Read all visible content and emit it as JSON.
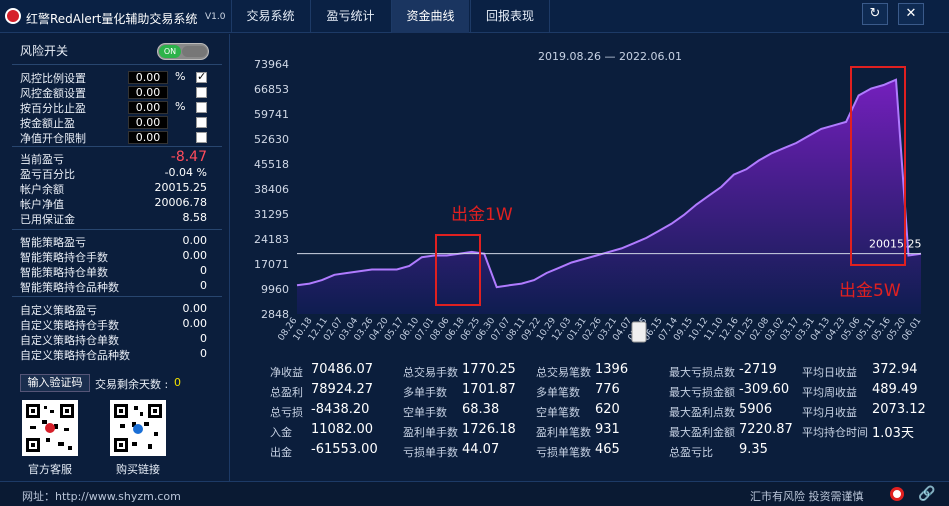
{
  "app": {
    "title": "红警RedAlert量化辅助交易系统",
    "version": "V1.0"
  },
  "tabs": [
    "交易系统",
    "盈亏统计",
    "资金曲线",
    "回报表现"
  ],
  "window_buttons": {
    "refresh": "↻",
    "close": "✕"
  },
  "risk": {
    "switch_label": "风险开关",
    "switch_state": "ON",
    "settings": [
      {
        "label": "风控比例设置",
        "value": "0.00",
        "unit": "%",
        "checked": true
      },
      {
        "label": "风控金额设置",
        "value": "0.00",
        "unit": "",
        "checked": false
      },
      {
        "label": "按百分比止盈",
        "value": "0.00",
        "unit": "%",
        "checked": false
      },
      {
        "label": "按金额止盈",
        "value": "0.00",
        "unit": "",
        "checked": false
      },
      {
        "label": "净值开仓限制",
        "value": "0.00",
        "unit": "",
        "checked": false
      }
    ]
  },
  "account": [
    {
      "label": "当前盈亏",
      "value": "-8.47"
    },
    {
      "label": "盈亏百分比",
      "value": "-0.04 %"
    },
    {
      "label": "帐户余额",
      "value": "20015.25"
    },
    {
      "label": "帐户净值",
      "value": "20006.78"
    },
    {
      "label": "已用保证金",
      "value": "8.58"
    }
  ],
  "smart": [
    {
      "label": "智能策略盈亏",
      "value": "0.00"
    },
    {
      "label": "智能策略持仓手数",
      "value": "0.00"
    },
    {
      "label": "智能策略持仓单数",
      "value": "0"
    },
    {
      "label": "智能策略持仓品种数",
      "value": "0"
    }
  ],
  "custom": [
    {
      "label": "自定义策略盈亏",
      "value": "0.00"
    },
    {
      "label": "自定义策略持仓手数",
      "value": "0.00"
    },
    {
      "label": "自定义策略持仓单数",
      "value": "0"
    },
    {
      "label": "自定义策略持仓品种数",
      "value": "0"
    }
  ],
  "verify": {
    "button": "输入验证码",
    "days_label": "交易剩余天数 :",
    "days_value": "0"
  },
  "qr": {
    "service": "官方客服",
    "buy": "购买链接"
  },
  "chart_data": {
    "type": "area",
    "title": "2019.08.26 — 2022.06.01",
    "y_ticks": [
      "73964",
      "66853",
      "59741",
      "52630",
      "45518",
      "38406",
      "31295",
      "24183",
      "17071",
      "9960",
      "2848"
    ],
    "ylim": [
      2848,
      73964
    ],
    "x_ticks": [
      "08.26",
      "10.18",
      "12.11",
      "02.07",
      "03.04",
      "03.26",
      "04.20",
      "05.17",
      "06.10",
      "07.01",
      "08.06",
      "06.18",
      "06.25",
      "06.30",
      "07.07",
      "08.11",
      "09.22",
      "10.29",
      "12.03",
      "01.31",
      "02.26",
      "03.21",
      "04.07",
      "05.05",
      "06.15",
      "07.14",
      "09.15",
      "10.12",
      "11.10",
      "12.16",
      "01.25",
      "02.08",
      "03.02",
      "03.17",
      "03.31",
      "04.13",
      "04.23",
      "05.06",
      "05.11",
      "05.16",
      "05.20",
      "06.01"
    ],
    "current_label": "20015.25",
    "current_value": 20015.25,
    "annotations": [
      {
        "text": "出金1W"
      },
      {
        "text": "出金5W"
      }
    ],
    "series": [
      {
        "x": [
          0,
          2,
          4,
          6,
          8,
          10,
          12,
          14,
          16,
          18,
          20,
          22,
          24,
          26,
          28,
          30,
          32,
          34,
          36,
          38,
          40,
          42,
          44,
          46,
          48,
          50,
          52,
          54,
          56,
          58,
          60,
          62,
          64,
          66,
          68,
          70,
          72,
          74,
          76,
          78,
          80,
          82,
          84,
          86,
          88,
          90,
          92,
          94,
          96,
          98,
          100
        ],
        "values": [
          11000,
          11500,
          12500,
          14000,
          14500,
          15000,
          15500,
          15500,
          15500,
          16500,
          19000,
          19500,
          19500,
          20000,
          20500,
          20000,
          10500,
          11000,
          11500,
          12500,
          14500,
          16000,
          17500,
          18500,
          19500,
          20500,
          21500,
          23000,
          24500,
          26500,
          28500,
          31000,
          34000,
          36500,
          39000,
          42500,
          44000,
          46500,
          48500,
          50000,
          51500,
          53500,
          55500,
          56500,
          57500,
          65000,
          67000,
          68000,
          69500,
          19500,
          20015
        ]
      }
    ]
  },
  "stats": [
    {
      "label": "净收益",
      "value": "70486.07"
    },
    {
      "label": "总盈利",
      "value": "78924.27"
    },
    {
      "label": "总亏损",
      "value": "-8438.20"
    },
    {
      "label": "入金",
      "value": "11082.00"
    },
    {
      "label": "出金",
      "value": "-61553.00"
    },
    {
      "label": "总交易手数",
      "value": "1770.25"
    },
    {
      "label": "多单手数",
      "value": "1701.87"
    },
    {
      "label": "空单手数",
      "value": "68.38"
    },
    {
      "label": "盈利单手数",
      "value": "1726.18"
    },
    {
      "label": "亏损单手数",
      "value": "44.07"
    },
    {
      "label": "总交易笔数",
      "value": "1396"
    },
    {
      "label": "多单笔数",
      "value": "776"
    },
    {
      "label": "空单笔数",
      "value": "620"
    },
    {
      "label": "盈利单笔数",
      "value": "931"
    },
    {
      "label": "亏损单笔数",
      "value": "465"
    },
    {
      "label": "最大亏损点数",
      "value": "-2719"
    },
    {
      "label": "最大亏损金额",
      "value": "-309.60"
    },
    {
      "label": "最大盈利点数",
      "value": "5906"
    },
    {
      "label": "最大盈利金额",
      "value": "7220.87"
    },
    {
      "label": "总盈亏比",
      "value": "9.35"
    },
    {
      "label": "平均日收益",
      "value": "372.94"
    },
    {
      "label": "平均周收益",
      "value": "489.49"
    },
    {
      "label": "平均月收益",
      "value": "2073.12"
    },
    {
      "label": "平均持仓时间",
      "value": "1.03天"
    }
  ],
  "footer": {
    "url": "网址：http://www.shyzm.com",
    "risk": "汇市有风险  投资需谨慎"
  },
  "colors": {
    "line": "#b07bff",
    "fill_top": "#7a1fc4",
    "fill_bottom": "#0f1d52",
    "highlight": "#e02020"
  }
}
